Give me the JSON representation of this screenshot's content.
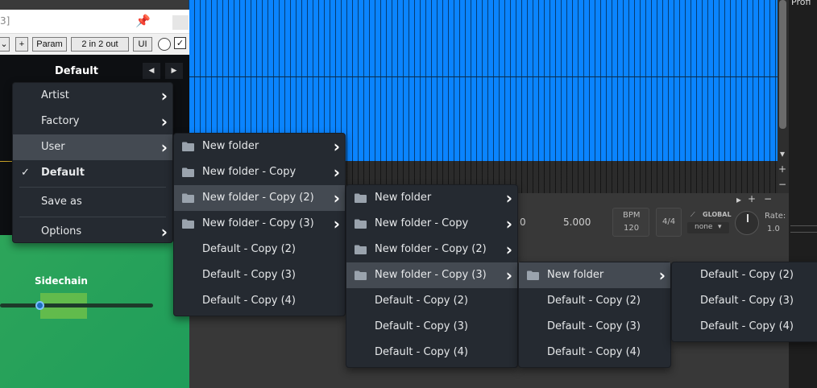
{
  "plugin": {
    "title_fragment": "3]",
    "toolbar": {
      "plus": "+",
      "param": "Param",
      "io": "2 in 2 out",
      "ui": "UI",
      "check": "✓",
      "dropdown": "⌄"
    },
    "preset": "Default",
    "prev": "◀",
    "next": "▶",
    "sidechain_label": "Sidechain"
  },
  "transport": {
    "time_a": "0",
    "time_b": "5.000",
    "bpm_label": "BPM",
    "bpm_value": "120",
    "signature": "4/4",
    "global_label": "GLOBAL",
    "global_value": "none",
    "rate_label": "Rate:",
    "rate_value": "1.0"
  },
  "right_panel_text": "Profi",
  "menu1": {
    "items": [
      {
        "label": "Artist",
        "submenu": true
      },
      {
        "label": "Factory",
        "submenu": true
      },
      {
        "label": "User",
        "submenu": true,
        "highlighted": true
      },
      {
        "label": "Default",
        "checked": true
      },
      {
        "label": "Save as"
      },
      {
        "label": "Options",
        "submenu": true
      }
    ]
  },
  "menu2": {
    "items": [
      {
        "label": "New folder",
        "folder": true,
        "submenu": true
      },
      {
        "label": "New folder - Copy",
        "folder": true,
        "submenu": true
      },
      {
        "label": "New folder - Copy (2)",
        "folder": true,
        "submenu": true,
        "highlighted": true
      },
      {
        "label": "New folder - Copy (3)",
        "folder": true,
        "submenu": true
      },
      {
        "label": "Default - Copy (2)"
      },
      {
        "label": "Default - Copy (3)"
      },
      {
        "label": "Default - Copy (4)"
      }
    ]
  },
  "menu3": {
    "items": [
      {
        "label": "New folder",
        "folder": true,
        "submenu": true
      },
      {
        "label": "New folder - Copy",
        "folder": true,
        "submenu": true
      },
      {
        "label": "New folder - Copy (2)",
        "folder": true,
        "submenu": true
      },
      {
        "label": "New folder - Copy (3)",
        "folder": true,
        "submenu": true,
        "highlighted": true
      },
      {
        "label": "Default - Copy (2)"
      },
      {
        "label": "Default - Copy (3)"
      },
      {
        "label": "Default - Copy (4)"
      }
    ]
  },
  "menu4": {
    "items": [
      {
        "label": "New folder",
        "folder": true,
        "submenu": true,
        "highlighted": true
      },
      {
        "label": "Default - Copy (2)"
      },
      {
        "label": "Default - Copy (3)"
      },
      {
        "label": "Default - Copy (4)"
      }
    ]
  },
  "menu5": {
    "items": [
      {
        "label": "Default - Copy (2)"
      },
      {
        "label": "Default - Copy (3)"
      },
      {
        "label": "Default - Copy (4)"
      }
    ]
  },
  "colors": {
    "menu_bg": "#252a31",
    "menu_highlight": "#444a52",
    "track_blue": "#0a84ff",
    "plugin_green": "#2da55a"
  }
}
